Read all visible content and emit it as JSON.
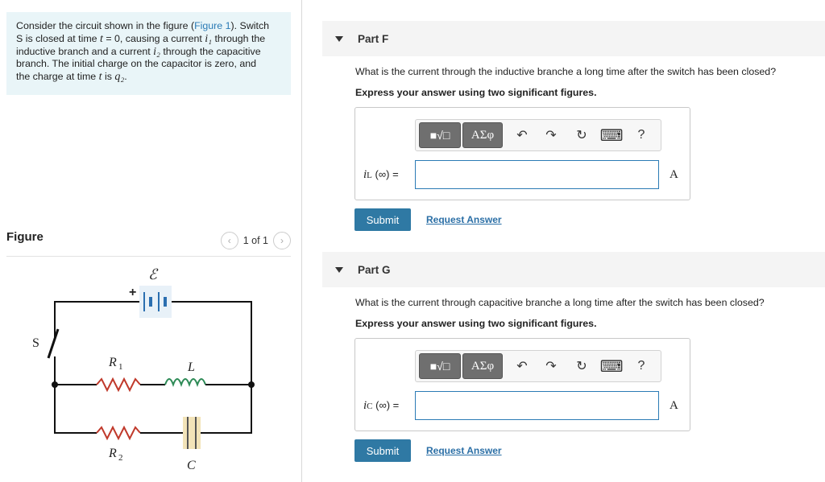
{
  "intro": {
    "line1_a": "Consider the circuit shown in the figure (",
    "figure_link": "Figure 1",
    "line1_b": "). Switch",
    "line2_sym": "S",
    "line2_a": " is closed at time ",
    "t": "t",
    "line2_b": " = 0, causing a current ",
    "i1": "i₁",
    "line2_c": " through the",
    "line3_a": "inductive branch and a current ",
    "i2": "i₂",
    "line3_b": " through the capacitive",
    "line4": "branch. The initial charge on the capacitor is zero, and",
    "line5_a": "the charge at time ",
    "line5_b": " is ",
    "q2": "q₂",
    "line5_c": "."
  },
  "figure": {
    "title": "Figure",
    "page_text": "1 of 1",
    "labels": {
      "emf": "ℰ",
      "plus": "+",
      "switch": "S",
      "r1": "R",
      "r1_sub": "1",
      "l": "L",
      "r2": "R",
      "r2_sub": "2",
      "c": "C"
    }
  },
  "icons": {
    "triangle": "caret-down",
    "undo": "↶",
    "redo": "↷",
    "reset": "↻",
    "keyboard": "⌨",
    "help": "?"
  },
  "parts": [
    {
      "title": "Part F",
      "question": "What is the current through the inductive branche a long time after the switch has been closed?",
      "instruction": "Express your answer using two significant figures.",
      "toolbar": {
        "templates": "■√□",
        "greek": "AΣφ"
      },
      "var": "i",
      "var_sub": "L",
      "var_rest": "(∞) =",
      "input_value": "",
      "unit": "A",
      "submit": "Submit",
      "request": "Request Answer"
    },
    {
      "title": "Part G",
      "question": "What is the current through capacitive branche a long time after the switch has been closed?",
      "instruction": "Express your answer using two significant figures.",
      "toolbar": {
        "templates": "■√□",
        "greek": "AΣφ"
      },
      "var": "i",
      "var_sub": "C",
      "var_rest": "(∞) =",
      "input_value": "",
      "unit": "A",
      "submit": "Submit",
      "request": "Request Answer"
    }
  ]
}
